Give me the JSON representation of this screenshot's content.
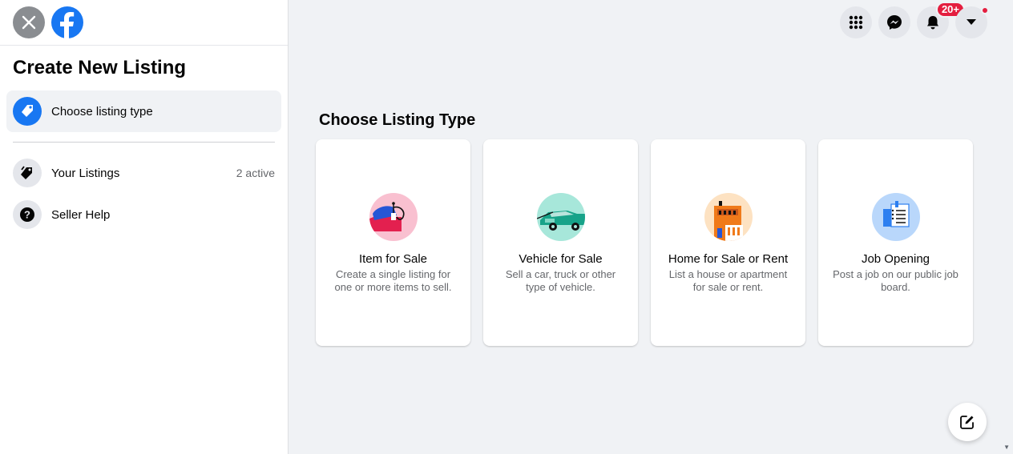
{
  "sidebar": {
    "title": "Create New Listing",
    "choose_label": "Choose listing type",
    "items": [
      {
        "label": "Your Listings",
        "meta": "2 active",
        "icon": "tag-icon"
      },
      {
        "label": "Seller Help",
        "meta": "",
        "icon": "question-icon"
      }
    ]
  },
  "topnav": {
    "notifications_badge": "20+"
  },
  "main": {
    "title": "Choose Listing Type",
    "cards": [
      {
        "title": "Item for Sale",
        "desc": "Create a single listing for one or more items to sell.",
        "icon": "item-illustration"
      },
      {
        "title": "Vehicle for Sale",
        "desc": "Sell a car, truck or other type of vehicle.",
        "icon": "vehicle-illustration"
      },
      {
        "title": "Home for Sale or Rent",
        "desc": "List a house or apartment for sale or rent.",
        "icon": "home-illustration"
      },
      {
        "title": "Job Opening",
        "desc": "Post a job on our public job board.",
        "icon": "job-illustration"
      }
    ]
  },
  "colors": {
    "brand": "#1877f2",
    "background": "#f0f2f5",
    "badge": "#e41e3f"
  }
}
